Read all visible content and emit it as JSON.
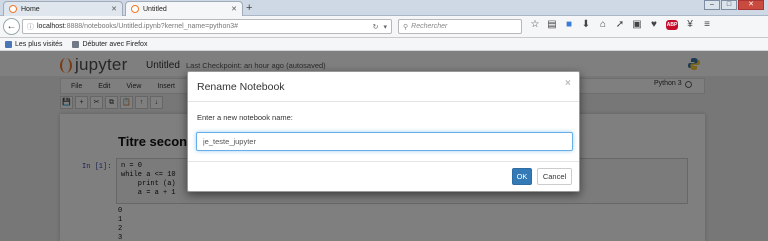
{
  "browser": {
    "tabs": [
      {
        "label": "Home"
      },
      {
        "label": "Untitled"
      }
    ],
    "new_tab_glyph": "+",
    "url_host": "localhost",
    "url_rest": ":8888/notebooks/Untitled.ipynb?kernel_name=python3#",
    "search_placeholder": "Rechercher",
    "bookmarks": [
      {
        "label": "Les plus visités"
      },
      {
        "label": "Débuter avec Firefox"
      }
    ],
    "adblock_label": "ABP"
  },
  "jupyter": {
    "logo_text": "jupyter",
    "notebook_title": "Untitled",
    "checkpoint": "Last Checkpoint: an hour ago (autosaved)",
    "menu": [
      "File",
      "Edit",
      "View",
      "Insert"
    ],
    "kernel": "Python 3",
    "toolbar": [
      "💾",
      "+",
      "✂",
      "⧉",
      "📋",
      "↑",
      "↓"
    ],
    "markdown_heading": "Titre secon",
    "prompt": "In [1]:",
    "code_lines": [
      "n = 0",
      "while a <= 10",
      "    print (a)",
      "    a = a + 1"
    ],
    "output_lines": [
      "0",
      "1",
      "2",
      "3"
    ]
  },
  "dialog": {
    "title": "Rename Notebook",
    "close_glyph": "×",
    "label": "Enter a new notebook name:",
    "input_value": "je_teste_jupyter",
    "ok_label": "OK",
    "cancel_label": "Cancel"
  },
  "colors": {
    "jupyter_orange": "#f37726",
    "primary_button": "#337ab7",
    "overlay": "#000000"
  }
}
